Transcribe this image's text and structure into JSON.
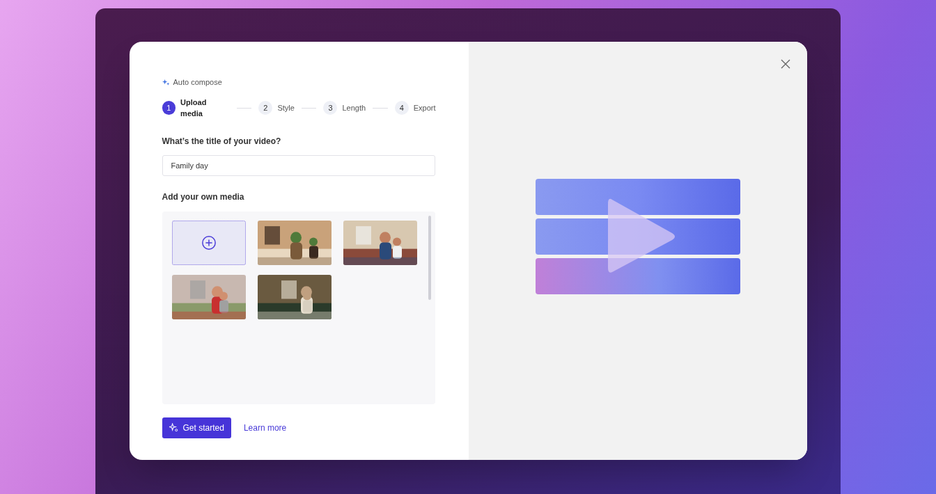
{
  "header": {
    "label": "Auto compose"
  },
  "steps": [
    {
      "number": "1",
      "label": "Upload media",
      "selected": true
    },
    {
      "number": "2",
      "label": "Style",
      "selected": false
    },
    {
      "number": "3",
      "label": "Length",
      "selected": false
    },
    {
      "number": "4",
      "label": "Export",
      "selected": false
    }
  ],
  "title_field": {
    "label": "What’s the title of your video?",
    "value": "Family day"
  },
  "media": {
    "label": "Add your own media",
    "items": [
      {
        "kind": "add"
      },
      {
        "kind": "picture"
      },
      {
        "kind": "picture"
      },
      {
        "kind": "picture"
      },
      {
        "kind": "picture"
      }
    ]
  },
  "primary_button": "Get started",
  "link": "Learn more"
}
